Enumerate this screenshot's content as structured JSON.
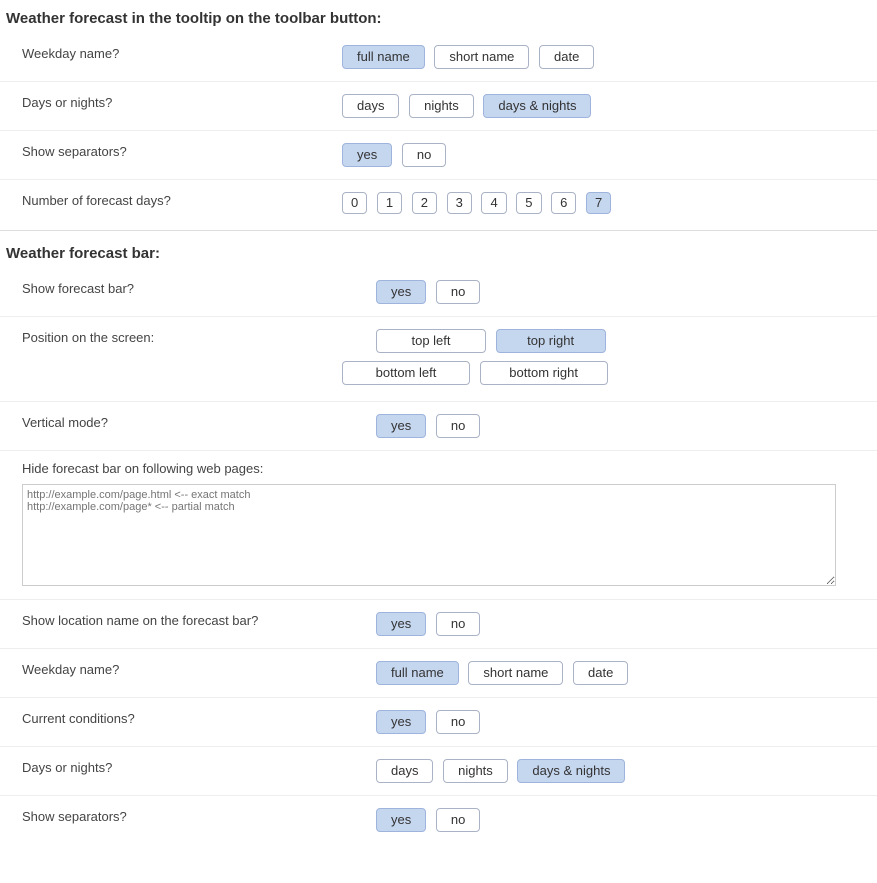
{
  "section1": {
    "title": "Weather forecast in the tooltip on the toolbar button:",
    "weekday": {
      "label": "Weekday name?",
      "options": [
        "full name",
        "short name",
        "date"
      ],
      "selected": 0
    },
    "days_nights": {
      "label": "Days or nights?",
      "options": [
        "days",
        "nights",
        "days & nights"
      ],
      "selected": 2
    },
    "separators": {
      "label": "Show separators?",
      "options": [
        "yes",
        "no"
      ],
      "selected": 0
    },
    "num_days": {
      "label": "Number of forecast days?",
      "options": [
        "0",
        "1",
        "2",
        "3",
        "4",
        "5",
        "6",
        "7"
      ],
      "selected": 7
    }
  },
  "section2": {
    "title": "Weather forecast bar:",
    "show_bar": {
      "label": "Show forecast bar?",
      "options": [
        "yes",
        "no"
      ],
      "selected": 0
    },
    "position": {
      "label": "Position on the screen:",
      "options": [
        "top left",
        "top right",
        "bottom left",
        "bottom right"
      ],
      "selected": 1
    },
    "vertical": {
      "label": "Vertical mode?",
      "options": [
        "yes",
        "no"
      ],
      "selected": 0
    },
    "hide_pages": {
      "label": "Hide forecast bar on following web pages:",
      "placeholder": "http://example.com/page.html <-- exact match\nhttp://example.com/page* <-- partial match"
    },
    "show_location": {
      "label": "Show location name on the forecast bar?",
      "options": [
        "yes",
        "no"
      ],
      "selected": 0
    },
    "weekday": {
      "label": "Weekday name?",
      "options": [
        "full name",
        "short name",
        "date"
      ],
      "selected": 0
    },
    "current": {
      "label": "Current conditions?",
      "options": [
        "yes",
        "no"
      ],
      "selected": 0
    },
    "days_nights": {
      "label": "Days or nights?",
      "options": [
        "days",
        "nights",
        "days & nights"
      ],
      "selected": 2
    },
    "separators": {
      "label": "Show separators?",
      "options": [
        "yes",
        "no"
      ],
      "selected": 0
    }
  }
}
